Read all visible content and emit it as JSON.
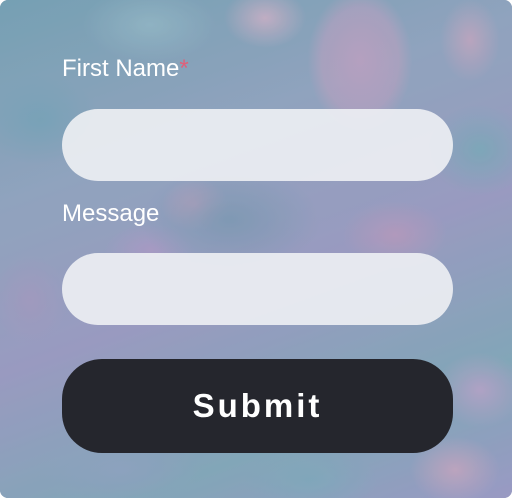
{
  "form": {
    "first_name": {
      "label": "First Name",
      "required_marker": "*",
      "value": "",
      "placeholder": ""
    },
    "message": {
      "label": "Message",
      "value": "",
      "placeholder": ""
    },
    "submit_label": "Submit"
  },
  "colors": {
    "label_text": "#ffffff",
    "required_marker": "#e0607a",
    "input_background": "#eceef2",
    "submit_background": "#25262d",
    "submit_text": "#ffffff"
  }
}
